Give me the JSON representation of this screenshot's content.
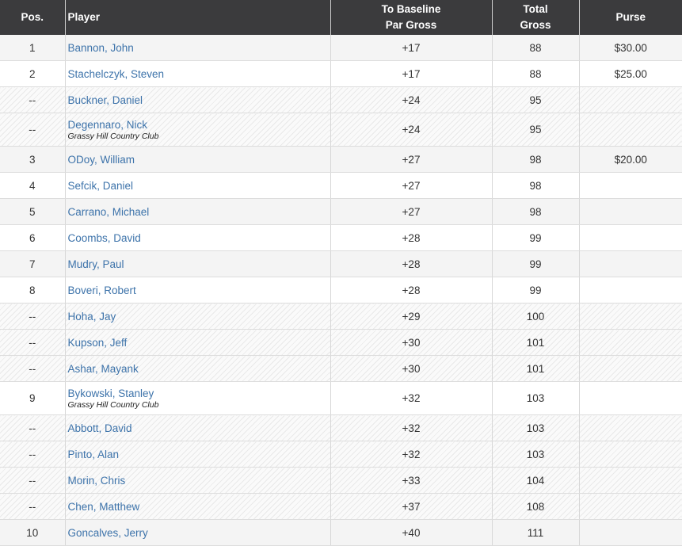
{
  "header": {
    "pos": "Pos.",
    "player": "Player",
    "baseline_line1": "To Baseline",
    "baseline_line2": "Par Gross",
    "total_line1": "Total",
    "total_line2": "Gross",
    "purse": "Purse"
  },
  "rows": [
    {
      "pos": "1",
      "player": "Bannon, John",
      "club": "",
      "baseline": "+17",
      "total": "88",
      "purse": "$30.00",
      "style": "odd"
    },
    {
      "pos": "2",
      "player": "Stachelczyk, Steven",
      "club": "",
      "baseline": "+17",
      "total": "88",
      "purse": "$25.00",
      "style": "even"
    },
    {
      "pos": "--",
      "player": "Buckner, Daniel",
      "club": "",
      "baseline": "+24",
      "total": "95",
      "purse": "",
      "style": "hatch"
    },
    {
      "pos": "--",
      "player": "Degennaro, Nick",
      "club": "Grassy Hill Country Club",
      "baseline": "+24",
      "total": "95",
      "purse": "",
      "style": "hatch"
    },
    {
      "pos": "3",
      "player": "ODoy, William",
      "club": "",
      "baseline": "+27",
      "total": "98",
      "purse": "$20.00",
      "style": "odd"
    },
    {
      "pos": "4",
      "player": "Sefcik, Daniel",
      "club": "",
      "baseline": "+27",
      "total": "98",
      "purse": "",
      "style": "even"
    },
    {
      "pos": "5",
      "player": "Carrano, Michael",
      "club": "",
      "baseline": "+27",
      "total": "98",
      "purse": "",
      "style": "odd"
    },
    {
      "pos": "6",
      "player": "Coombs, David",
      "club": "",
      "baseline": "+28",
      "total": "99",
      "purse": "",
      "style": "even"
    },
    {
      "pos": "7",
      "player": "Mudry, Paul",
      "club": "",
      "baseline": "+28",
      "total": "99",
      "purse": "",
      "style": "odd"
    },
    {
      "pos": "8",
      "player": "Boveri, Robert",
      "club": "",
      "baseline": "+28",
      "total": "99",
      "purse": "",
      "style": "even"
    },
    {
      "pos": "--",
      "player": "Hoha, Jay",
      "club": "",
      "baseline": "+29",
      "total": "100",
      "purse": "",
      "style": "hatch"
    },
    {
      "pos": "--",
      "player": "Kupson, Jeff",
      "club": "",
      "baseline": "+30",
      "total": "101",
      "purse": "",
      "style": "hatch"
    },
    {
      "pos": "--",
      "player": "Ashar, Mayank",
      "club": "",
      "baseline": "+30",
      "total": "101",
      "purse": "",
      "style": "hatch"
    },
    {
      "pos": "9",
      "player": "Bykowski, Stanley",
      "club": "Grassy Hill Country Club",
      "baseline": "+32",
      "total": "103",
      "purse": "",
      "style": "even"
    },
    {
      "pos": "--",
      "player": "Abbott, David",
      "club": "",
      "baseline": "+32",
      "total": "103",
      "purse": "",
      "style": "hatch"
    },
    {
      "pos": "--",
      "player": "Pinto, Alan",
      "club": "",
      "baseline": "+32",
      "total": "103",
      "purse": "",
      "style": "hatch"
    },
    {
      "pos": "--",
      "player": "Morin, Chris",
      "club": "",
      "baseline": "+33",
      "total": "104",
      "purse": "",
      "style": "hatch"
    },
    {
      "pos": "--",
      "player": "Chen, Matthew",
      "club": "",
      "baseline": "+37",
      "total": "108",
      "purse": "",
      "style": "hatch"
    },
    {
      "pos": "10",
      "player": "Goncalves, Jerry",
      "club": "",
      "baseline": "+40",
      "total": "111",
      "purse": "",
      "style": "odd"
    }
  ],
  "colors": {
    "header_bg": "#3b3b3d",
    "link": "#3d73aa"
  }
}
